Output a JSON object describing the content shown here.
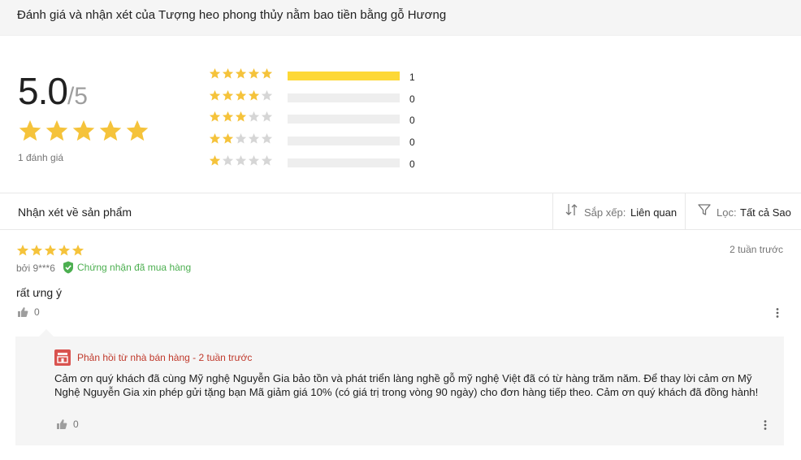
{
  "header": {
    "title": "Đánh giá và nhận xét của Tượng heo phong thủy nằm bao tiền bằng gỗ Hương"
  },
  "summary": {
    "score": "5.0",
    "max": "/5",
    "stars": 5,
    "review_count": "1 đánh giá",
    "breakdown": [
      {
        "stars": 5,
        "count": "1",
        "fraction": 1.0
      },
      {
        "stars": 4,
        "count": "0",
        "fraction": 0
      },
      {
        "stars": 3,
        "count": "0",
        "fraction": 0
      },
      {
        "stars": 2,
        "count": "0",
        "fraction": 0
      },
      {
        "stars": 1,
        "count": "0",
        "fraction": 0
      }
    ]
  },
  "filters": {
    "section_label": "Nhận xét về sản phẩm",
    "sort_label": "Sắp xếp:",
    "sort_value": "Liên quan",
    "filter_label": "Lọc:",
    "filter_value": "Tất cả Sao"
  },
  "review": {
    "stars": 5,
    "author": "bởi 9***6",
    "verified": "Chứng nhận đã mua hàng",
    "date": "2 tuần trước",
    "text": "rất ưng ý",
    "likes": "0",
    "reply": {
      "title": "Phản hồi từ nhà bán hàng - 2 tuần trước",
      "text": "Cảm ơn quý khách đã cùng Mỹ nghệ Nguyễn Gia bảo tồn và phát triển làng nghề gỗ mỹ nghệ Việt đã có từ hàng trăm năm. Để thay lời cảm ơn Mỹ Nghệ Nguyễn Gia xin phép gửi tặng bạn Mã giảm giá 10% (có giá trị trong vòng 90 ngày) cho đơn hàng tiếp theo. Cảm ơn quý khách đã đồng hành!",
      "likes": "0"
    }
  },
  "colors": {
    "star": "#f5c33b",
    "star_empty": "#d6d6d6",
    "bar_fill": "#fdd836",
    "verified": "#4caf50",
    "reply_title": "#c0392b"
  },
  "icons": [
    "star-icon",
    "sort-icon",
    "filter-icon",
    "verified-check-icon",
    "thumbs-up-icon",
    "more-icon",
    "shop-icon"
  ]
}
